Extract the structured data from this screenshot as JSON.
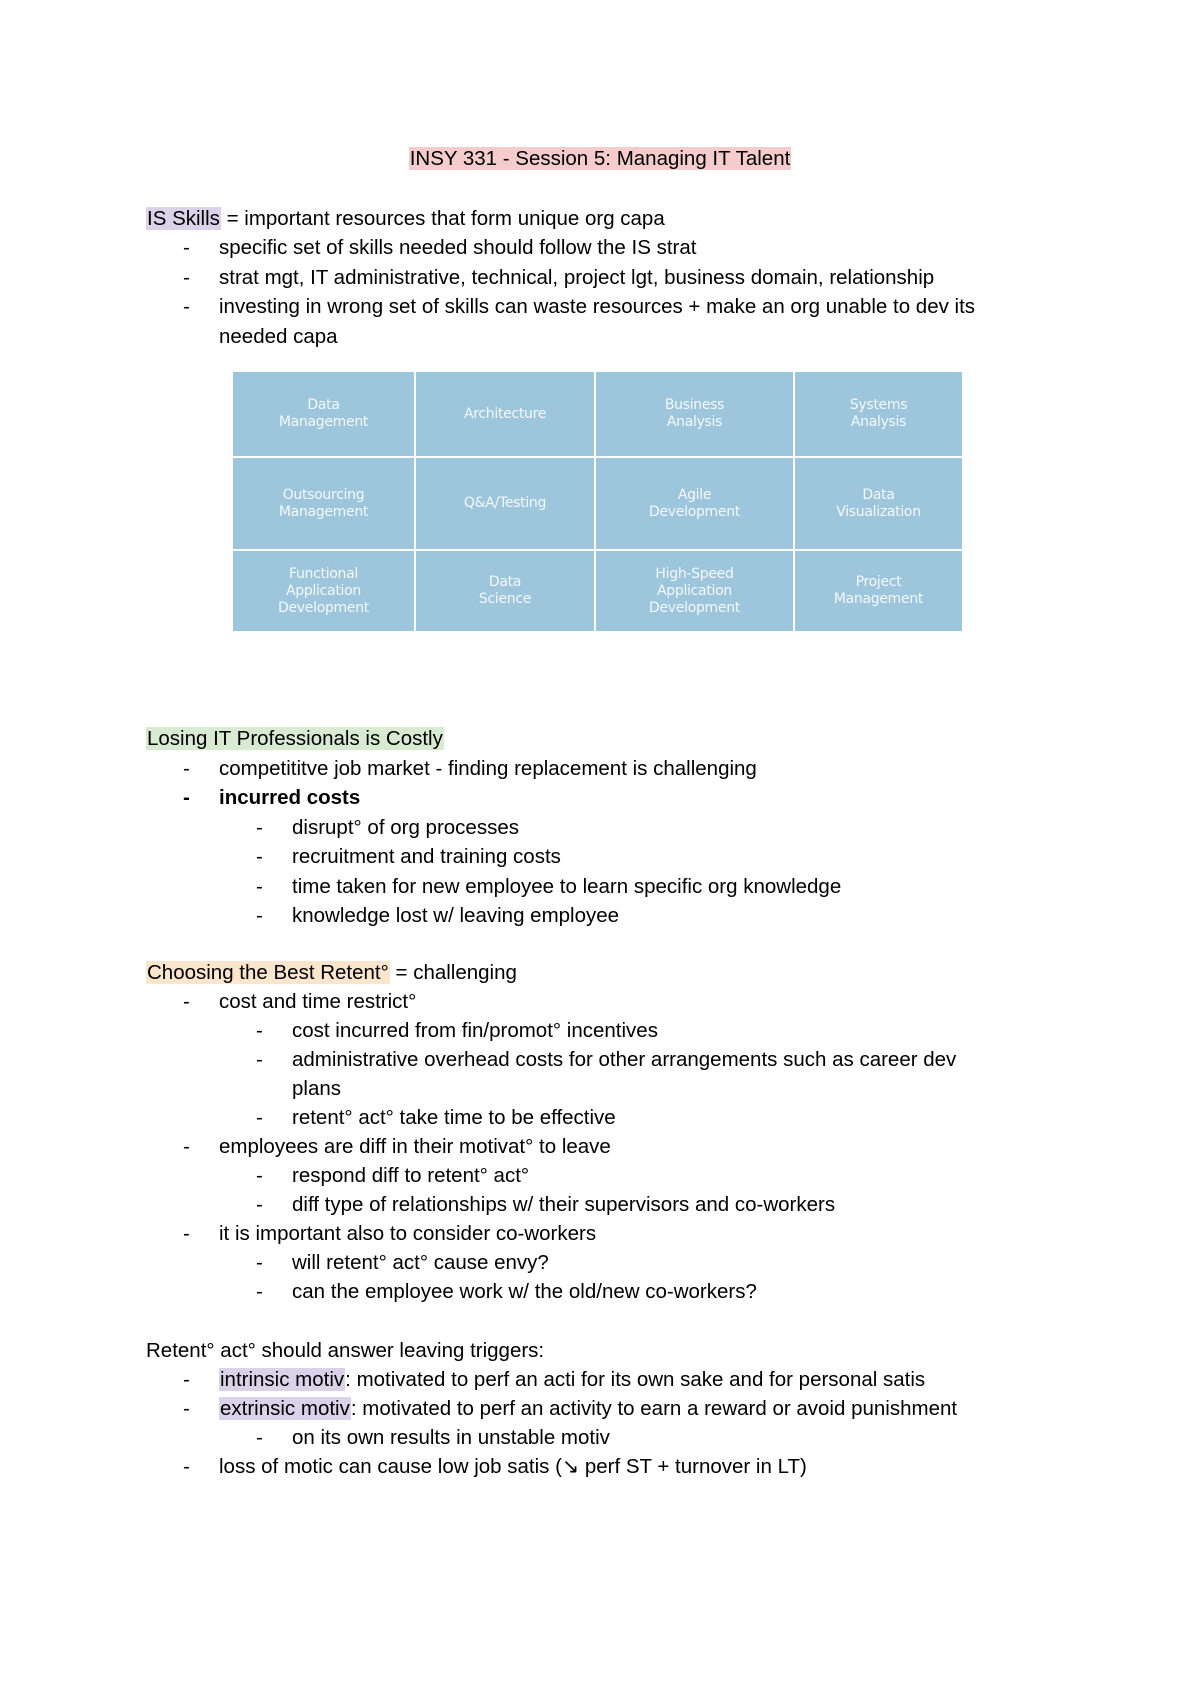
{
  "title": "INSY 331 - Session 5: Managing IT Talent",
  "colors": {
    "title_highlight": "#f4cccc",
    "purple_highlight": "#d9d2e9",
    "green_highlight": "#d9ead3",
    "orange_highlight": "#fce5cd",
    "grid_cell": "#9dc5db"
  },
  "is_skills": {
    "term": "IS Skills",
    "definition": " = important resources that form unique org capa",
    "bullets": [
      "specific set of skills needed should follow the IS strat",
      "strat mgt, IT administrative, technical, project lgt, business domain, relationship",
      "investing in wrong set of skills can waste resources + make an org unable to dev its",
      "needed capa"
    ]
  },
  "skills_grid": [
    [
      "Data\nManagement",
      "Architecture",
      "Business\nAnalysis",
      "Systems\nAnalysis"
    ],
    [
      "Outsourcing\nManagement",
      "Q&A/Testing",
      "Agile\nDevelopment",
      "Data\nVisualization"
    ],
    [
      "Functional\nApplication\nDevelopment",
      "Data\nScience",
      "High-Speed\nApplication\nDevelopment",
      "Project\nManagement"
    ]
  ],
  "losing": {
    "heading": "Losing IT Professionals is Costly",
    "bullet1": "competititve job market - finding replacement is challenging",
    "bullet2": "incurred costs",
    "sub": [
      "disrupt° of org processes",
      "recruitment and training costs",
      "time taken for new employee to learn specific org knowledge",
      "knowledge lost w/ leaving employee"
    ]
  },
  "choosing": {
    "heading": "Choosing the Best Retent°",
    "heading_suffix": " = challenging",
    "b1": "cost and time restrict°",
    "b1_sub": [
      "cost incurred from fin/promot° incentives",
      "administrative overhead costs for other arrangements such as career dev",
      "plans",
      "retent° act° take time to be effective"
    ],
    "b2": "employees are diff in their motivat° to leave",
    "b2_sub": [
      "respond diff to retent° act°",
      "diff type of relationships w/ their supervisors and co-workers"
    ],
    "b3": "it is important also to consider co-workers",
    "b3_sub": [
      "will retent° act° cause envy?",
      "can the employee work w/ the old/new co-workers?"
    ]
  },
  "triggers": {
    "heading": "Retent° act° should answer leaving triggers:",
    "intrinsic_term": "intrinsic motiv",
    "intrinsic_text": ": motivated to perf an acti for its own sake and for personal satis",
    "extrinsic_term": "extrinsic motiv",
    "extrinsic_text": ": motivated to perf an activity to earn a reward or avoid punishment",
    "extrinsic_sub": "on its own results in unstable motiv",
    "loss": "loss of motic can cause low job satis (↘ perf ST + turnover in LT)"
  },
  "dash": "-"
}
